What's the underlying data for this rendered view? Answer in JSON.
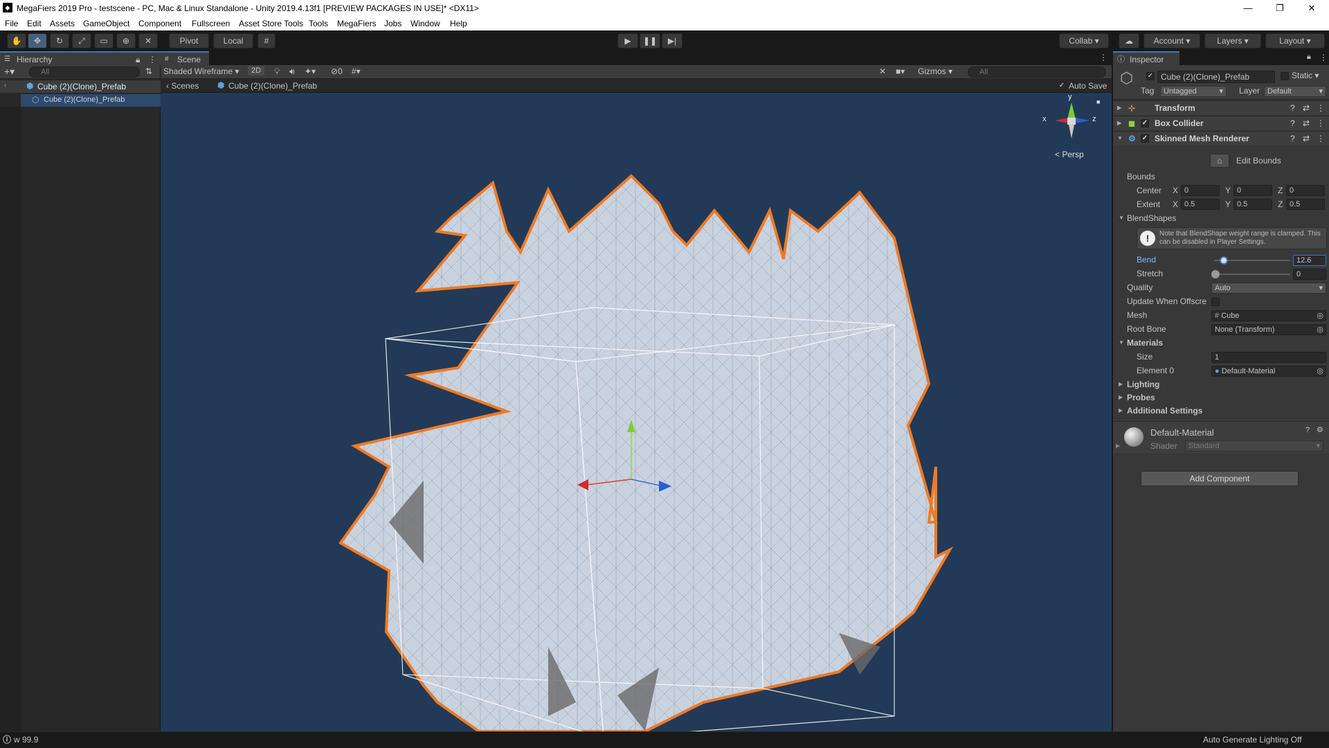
{
  "window": {
    "title": "MegaFiers 2019 Pro - testscene - PC, Mac & Linux Standalone - Unity 2019.4.13f1 [PREVIEW PACKAGES IN USE]* <DX11>",
    "minimize": "—",
    "maximize": "❐",
    "close": "✕"
  },
  "menu": [
    "File",
    "Edit",
    "Assets",
    "GameObject",
    "Component",
    "Fullscreen",
    "Asset Store Tools",
    "Tools",
    "MegaFiers",
    "Jobs",
    "Window",
    "Help"
  ],
  "toolbar": {
    "pivot": "Pivot",
    "local": "Local",
    "collab": "Collab",
    "account": "Account",
    "layers": "Layers",
    "layout": "Layout"
  },
  "hierarchy": {
    "tab": "Hierarchy",
    "search_placeholder": "All",
    "root": "Cube (2)(Clone)_Prefab",
    "child": "Cube (2)(Clone)_Prefab"
  },
  "scene": {
    "tab": "Scene",
    "shading": "Shaded Wireframe",
    "mode2d": "2D",
    "hidden_count": "0",
    "gizmos": "Gizmos",
    "search_placeholder": "All",
    "breadcrumb_root": "Scenes",
    "breadcrumb_item": "Cube (2)(Clone)_Prefab",
    "auto_save": "Auto Save",
    "persp": "Persp",
    "axis_x": "x",
    "axis_y": "y",
    "axis_z": "z"
  },
  "inspector": {
    "tab": "Inspector",
    "object_name": "Cube (2)(Clone)_Prefab",
    "static": "Static",
    "tag_label": "Tag",
    "tag_value": "Untagged",
    "layer_label": "Layer",
    "layer_value": "Default",
    "components": {
      "transform": "Transform",
      "box_collider": "Box Collider",
      "skinned_mesh_renderer": "Skinned Mesh Renderer"
    },
    "edit_bounds": "Edit Bounds",
    "bounds_label": "Bounds",
    "center_label": "Center",
    "extent_label": "Extent",
    "center": {
      "x": "0",
      "y": "0",
      "z": "0"
    },
    "extent": {
      "x": "0.5",
      "y": "0.5",
      "z": "0.5"
    },
    "axis_x": "X",
    "axis_y": "Y",
    "axis_z": "Z",
    "blendshapes_label": "BlendShapes",
    "note": "Note that BlendShape weight range is clamped. This can be disabled in Player Settings.",
    "bend_label": "Bend",
    "bend_value": "12.6",
    "bend_fraction": 0.126,
    "stretch_label": "Stretch",
    "stretch_value": "0",
    "quality_label": "Quality",
    "quality_value": "Auto",
    "update_offscreen_label": "Update When Offscre",
    "mesh_label": "Mesh",
    "mesh_value": "Cube",
    "root_bone_label": "Root Bone",
    "root_bone_value": "None (Transform)",
    "materials_label": "Materials",
    "size_label": "Size",
    "size_value": "1",
    "element0_label": "Element 0",
    "element0_value": "Default-Material",
    "lighting": "Lighting",
    "probes": "Probes",
    "additional_settings": "Additional Settings",
    "material_name": "Default-Material",
    "shader_label": "Shader",
    "shader_value": "Standard",
    "add_component": "Add Component"
  },
  "status": {
    "left": "w 99.9",
    "right": "Auto Generate Lighting Off"
  },
  "colors": {
    "selection_outline": "#f07a24",
    "scene_bg": "#223a57",
    "accent_blue": "#3a79bb"
  }
}
